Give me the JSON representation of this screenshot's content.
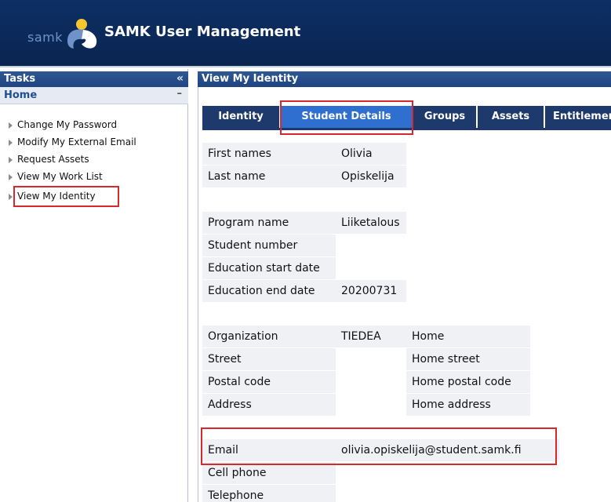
{
  "header": {
    "logo_text": "samk",
    "title": "SAMK User Management",
    "brand_colors": {
      "header_bg": "#0b2a5a",
      "accent": "#2e6fd0",
      "highlight": "#d6282d"
    }
  },
  "tasks_panel": {
    "title": "Tasks",
    "collapse_symbol": "«",
    "section_title": "Home",
    "minimize_symbol": "–",
    "items": [
      {
        "label": "Change My Password"
      },
      {
        "label": "Modify My External Email"
      },
      {
        "label": "Request Assets"
      },
      {
        "label": "View My Work List"
      },
      {
        "label": "View My Identity"
      }
    ]
  },
  "main": {
    "title": "View My Identity",
    "tabs": [
      {
        "label": "Identity"
      },
      {
        "label": "Student Details"
      },
      {
        "label": "Groups"
      },
      {
        "label": "Assets"
      },
      {
        "label": "Entitlements"
      }
    ],
    "active_tab": "Student Details",
    "person": [
      {
        "label": "First names",
        "value": "Olivia"
      },
      {
        "label": "Last name",
        "value": "Opiskelija"
      }
    ],
    "program": [
      {
        "label": "Program name",
        "value": "Liiketalous"
      },
      {
        "label": "Student number",
        "value": ""
      },
      {
        "label": "Education start date",
        "value": ""
      },
      {
        "label": "Education end date",
        "value": "20200731"
      }
    ],
    "organization": [
      {
        "label": "Organization",
        "value": "TIEDEA",
        "home_value": "Home"
      },
      {
        "label": "Street",
        "value": "",
        "home_value": "Home street"
      },
      {
        "label": "Postal code",
        "value": "",
        "home_value": "Home postal code"
      },
      {
        "label": "Address",
        "value": "",
        "home_value": "Home address"
      }
    ],
    "contact": [
      {
        "label": "Email",
        "value": "olivia.opiskelija@student.samk.fi"
      },
      {
        "label": "Cell phone",
        "value": ""
      },
      {
        "label": "Telephone",
        "value": ""
      }
    ]
  }
}
